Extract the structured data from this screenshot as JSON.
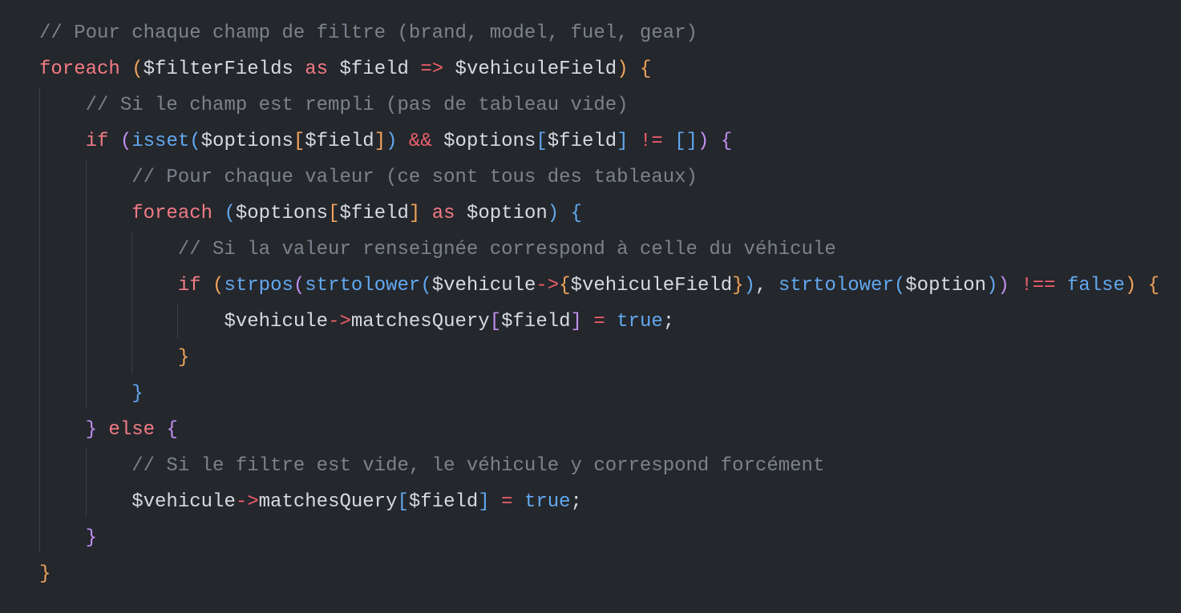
{
  "editor": {
    "background": "#24272c",
    "colors": {
      "keyword": "#f27b84",
      "variable": "#d7dae0",
      "comment": "#7c828c",
      "function": "#62a8ef",
      "operator": "#ef5f6b",
      "bracket_level_1": "#f0a35c",
      "bracket_level_2": "#c08ef0",
      "bracket_level_3": "#62a8ef"
    },
    "lines": [
      {
        "tokens": [
          {
            "t": "// Pour chaque champ de filtre (brand, model, fuel, gear)",
            "c": "cmt"
          }
        ]
      },
      {
        "tokens": [
          {
            "t": "foreach",
            "c": "kw"
          },
          {
            "t": " ",
            "c": "plain"
          },
          {
            "t": "(",
            "c": "p1"
          },
          {
            "t": "$filterFields",
            "c": "plain"
          },
          {
            "t": " ",
            "c": "plain"
          },
          {
            "t": "as",
            "c": "kw"
          },
          {
            "t": " ",
            "c": "plain"
          },
          {
            "t": "$field",
            "c": "plain"
          },
          {
            "t": " ",
            "c": "plain"
          },
          {
            "t": "=>",
            "c": "op"
          },
          {
            "t": " ",
            "c": "plain"
          },
          {
            "t": "$vehiculeField",
            "c": "plain"
          },
          {
            "t": ")",
            "c": "p1"
          },
          {
            "t": " ",
            "c": "plain"
          },
          {
            "t": "{",
            "c": "p1"
          }
        ]
      },
      {
        "tokens": [
          {
            "t": "    ",
            "c": "plain"
          },
          {
            "t": "// Si le champ est rempli (pas de tableau vide)",
            "c": "cmt"
          }
        ]
      },
      {
        "tokens": [
          {
            "t": "    ",
            "c": "plain"
          },
          {
            "t": "if",
            "c": "kw"
          },
          {
            "t": " ",
            "c": "plain"
          },
          {
            "t": "(",
            "c": "p2"
          },
          {
            "t": "isset",
            "c": "fn"
          },
          {
            "t": "(",
            "c": "p3"
          },
          {
            "t": "$options",
            "c": "plain"
          },
          {
            "t": "[",
            "c": "p1"
          },
          {
            "t": "$field",
            "c": "plain"
          },
          {
            "t": "]",
            "c": "p1"
          },
          {
            "t": ")",
            "c": "p3"
          },
          {
            "t": " ",
            "c": "plain"
          },
          {
            "t": "&&",
            "c": "op"
          },
          {
            "t": " ",
            "c": "plain"
          },
          {
            "t": "$options",
            "c": "plain"
          },
          {
            "t": "[",
            "c": "p3"
          },
          {
            "t": "$field",
            "c": "plain"
          },
          {
            "t": "]",
            "c": "p3"
          },
          {
            "t": " ",
            "c": "plain"
          },
          {
            "t": "!=",
            "c": "op"
          },
          {
            "t": " ",
            "c": "plain"
          },
          {
            "t": "[]",
            "c": "p3"
          },
          {
            "t": ")",
            "c": "p2"
          },
          {
            "t": " ",
            "c": "plain"
          },
          {
            "t": "{",
            "c": "p2"
          }
        ]
      },
      {
        "tokens": [
          {
            "t": "        ",
            "c": "plain"
          },
          {
            "t": "// Pour chaque valeur (ce sont tous des tableaux)",
            "c": "cmt"
          }
        ]
      },
      {
        "tokens": [
          {
            "t": "        ",
            "c": "plain"
          },
          {
            "t": "foreach",
            "c": "kw"
          },
          {
            "t": " ",
            "c": "plain"
          },
          {
            "t": "(",
            "c": "p3"
          },
          {
            "t": "$options",
            "c": "plain"
          },
          {
            "t": "[",
            "c": "p1"
          },
          {
            "t": "$field",
            "c": "plain"
          },
          {
            "t": "]",
            "c": "p1"
          },
          {
            "t": " ",
            "c": "plain"
          },
          {
            "t": "as",
            "c": "kw"
          },
          {
            "t": " ",
            "c": "plain"
          },
          {
            "t": "$option",
            "c": "plain"
          },
          {
            "t": ")",
            "c": "p3"
          },
          {
            "t": " ",
            "c": "plain"
          },
          {
            "t": "{",
            "c": "p3"
          }
        ]
      },
      {
        "tokens": [
          {
            "t": "            ",
            "c": "plain"
          },
          {
            "t": "// Si la valeur renseignée correspond à celle du véhicule",
            "c": "cmt"
          }
        ]
      },
      {
        "tokens": [
          {
            "t": "            ",
            "c": "plain"
          },
          {
            "t": "if",
            "c": "kw"
          },
          {
            "t": " ",
            "c": "plain"
          },
          {
            "t": "(",
            "c": "p1"
          },
          {
            "t": "strpos",
            "c": "fn"
          },
          {
            "t": "(",
            "c": "p2"
          },
          {
            "t": "strtolower",
            "c": "fn"
          },
          {
            "t": "(",
            "c": "p3"
          },
          {
            "t": "$vehicule",
            "c": "plain"
          },
          {
            "t": "->",
            "c": "op"
          },
          {
            "t": "{",
            "c": "p1"
          },
          {
            "t": "$vehiculeField",
            "c": "plain"
          },
          {
            "t": "}",
            "c": "p1"
          },
          {
            "t": ")",
            "c": "p3"
          },
          {
            "t": ", ",
            "c": "plain"
          },
          {
            "t": "strtolower",
            "c": "fn"
          },
          {
            "t": "(",
            "c": "p3"
          },
          {
            "t": "$option",
            "c": "plain"
          },
          {
            "t": ")",
            "c": "p3"
          },
          {
            "t": ")",
            "c": "p2"
          },
          {
            "t": " ",
            "c": "plain"
          },
          {
            "t": "!==",
            "c": "op"
          },
          {
            "t": " ",
            "c": "plain"
          },
          {
            "t": "false",
            "c": "bool"
          },
          {
            "t": ")",
            "c": "p1"
          },
          {
            "t": " ",
            "c": "plain"
          },
          {
            "t": "{",
            "c": "p1"
          }
        ]
      },
      {
        "tokens": [
          {
            "t": "                ",
            "c": "plain"
          },
          {
            "t": "$vehicule",
            "c": "plain"
          },
          {
            "t": "->",
            "c": "op"
          },
          {
            "t": "matchesQuery",
            "c": "plain"
          },
          {
            "t": "[",
            "c": "p2"
          },
          {
            "t": "$field",
            "c": "plain"
          },
          {
            "t": "]",
            "c": "p2"
          },
          {
            "t": " ",
            "c": "plain"
          },
          {
            "t": "=",
            "c": "op"
          },
          {
            "t": " ",
            "c": "plain"
          },
          {
            "t": "true",
            "c": "bool"
          },
          {
            "t": ";",
            "c": "plain"
          }
        ]
      },
      {
        "tokens": [
          {
            "t": "            ",
            "c": "plain"
          },
          {
            "t": "}",
            "c": "p1"
          }
        ]
      },
      {
        "tokens": [
          {
            "t": "        ",
            "c": "plain"
          },
          {
            "t": "}",
            "c": "p3"
          }
        ]
      },
      {
        "tokens": [
          {
            "t": "    ",
            "c": "plain"
          },
          {
            "t": "}",
            "c": "p2"
          },
          {
            "t": " ",
            "c": "plain"
          },
          {
            "t": "else",
            "c": "kw"
          },
          {
            "t": " ",
            "c": "plain"
          },
          {
            "t": "{",
            "c": "p2"
          }
        ]
      },
      {
        "tokens": [
          {
            "t": "        ",
            "c": "plain"
          },
          {
            "t": "// Si le filtre est vide, le véhicule y correspond forcément",
            "c": "cmt"
          }
        ]
      },
      {
        "tokens": [
          {
            "t": "        ",
            "c": "plain"
          },
          {
            "t": "$vehicule",
            "c": "plain"
          },
          {
            "t": "->",
            "c": "op"
          },
          {
            "t": "matchesQuery",
            "c": "plain"
          },
          {
            "t": "[",
            "c": "p3"
          },
          {
            "t": "$field",
            "c": "plain"
          },
          {
            "t": "]",
            "c": "p3"
          },
          {
            "t": " ",
            "c": "plain"
          },
          {
            "t": "=",
            "c": "op"
          },
          {
            "t": " ",
            "c": "plain"
          },
          {
            "t": "true",
            "c": "bool"
          },
          {
            "t": ";",
            "c": "plain"
          }
        ]
      },
      {
        "tokens": [
          {
            "t": "    ",
            "c": "plain"
          },
          {
            "t": "}",
            "c": "p2"
          }
        ]
      },
      {
        "tokens": [
          {
            "t": "}",
            "c": "p1"
          }
        ]
      }
    ]
  }
}
